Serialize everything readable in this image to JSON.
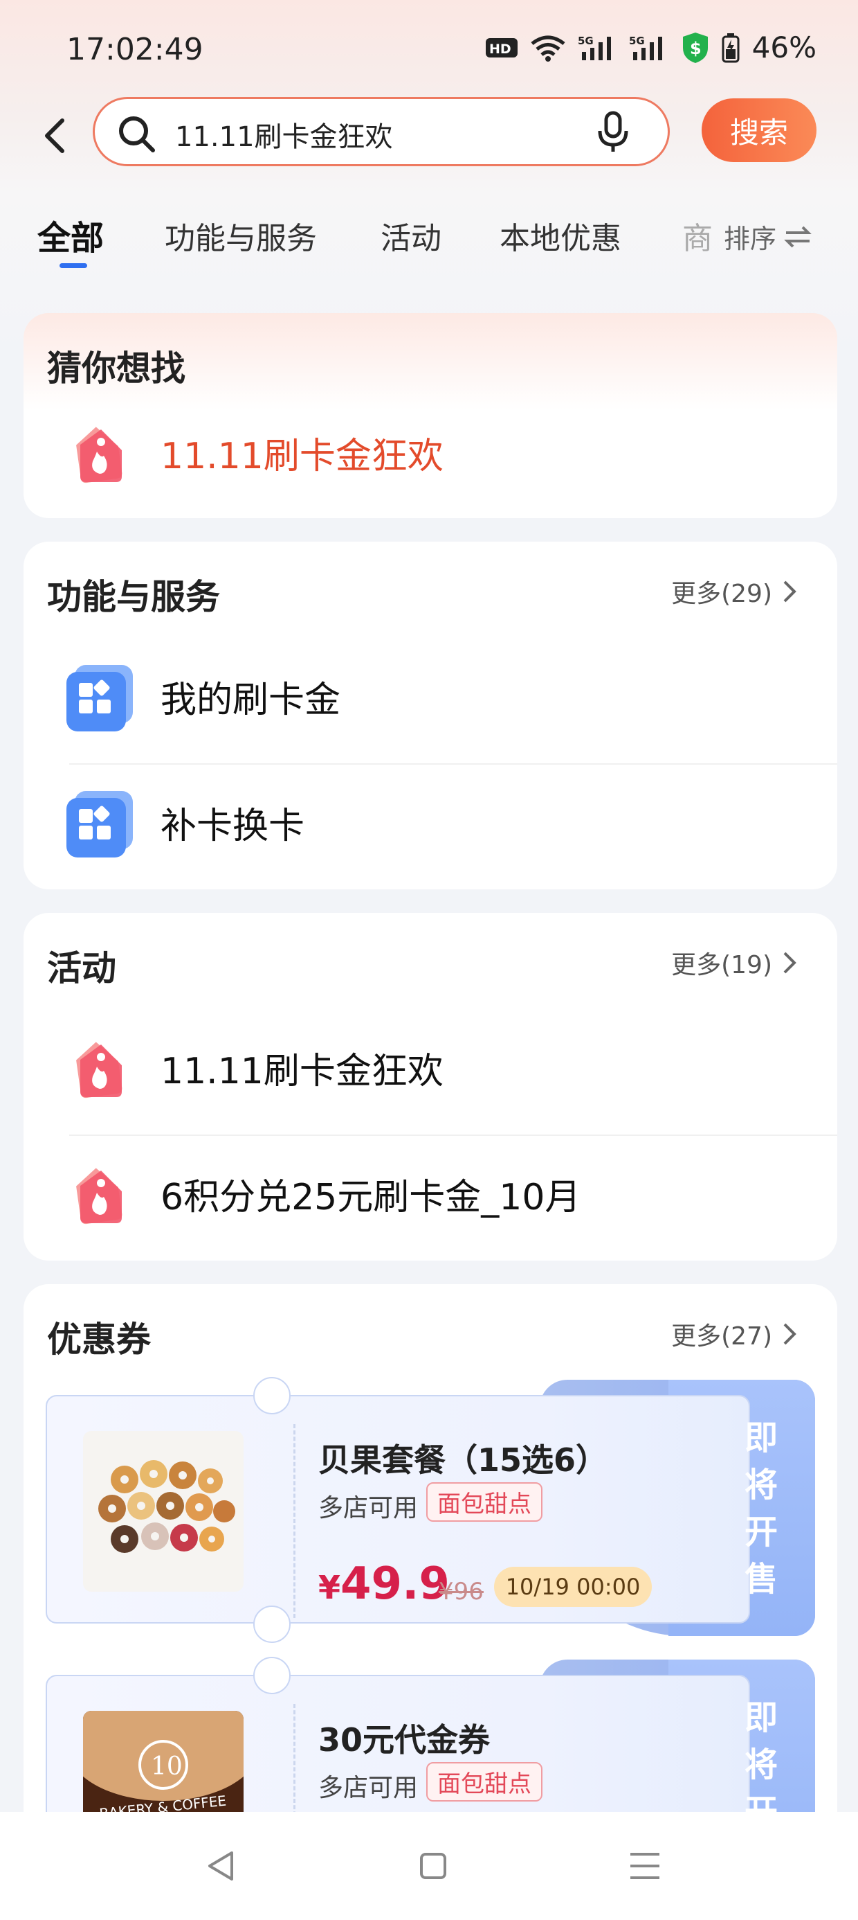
{
  "status_bar": {
    "time": "17:02:49",
    "hd": "HD",
    "net1": "5G",
    "net2": "5G",
    "battery": "46%"
  },
  "search": {
    "query": "11.11刷卡金狂欢",
    "button": "搜索"
  },
  "tabs": [
    "全部",
    "功能与服务",
    "活动",
    "本地优惠",
    "商"
  ],
  "sort_label": "排序",
  "guess": {
    "title": "猜你想找",
    "item": "11.11刷卡金狂欢"
  },
  "services": {
    "title": "功能与服务",
    "more": "更多(29)",
    "items": [
      "我的刷卡金",
      "补卡换卡"
    ]
  },
  "activities": {
    "title": "活动",
    "more": "更多(19)",
    "items": [
      "11.11刷卡金狂欢",
      "6积分兑25元刷卡金_10月"
    ]
  },
  "coupons": {
    "title": "优惠券",
    "more": "更多(27)",
    "items": [
      {
        "title": "贝果套餐（15选6）",
        "stores": "多店可用",
        "tag": "面包甜点",
        "price_symbol": "¥",
        "price": "49.9",
        "original": "¥96",
        "date": "10/19 00:00",
        "status": "即将开售"
      },
      {
        "title": "30元代金券",
        "stores": "多店可用",
        "tag": "面包甜点",
        "status": "即将开售",
        "logo_text": "BAKERY & COFFEE"
      }
    ]
  },
  "colors": {
    "accent": "#f4633c",
    "tab_indicator": "#2f6ff0",
    "price": "#d6204a"
  }
}
